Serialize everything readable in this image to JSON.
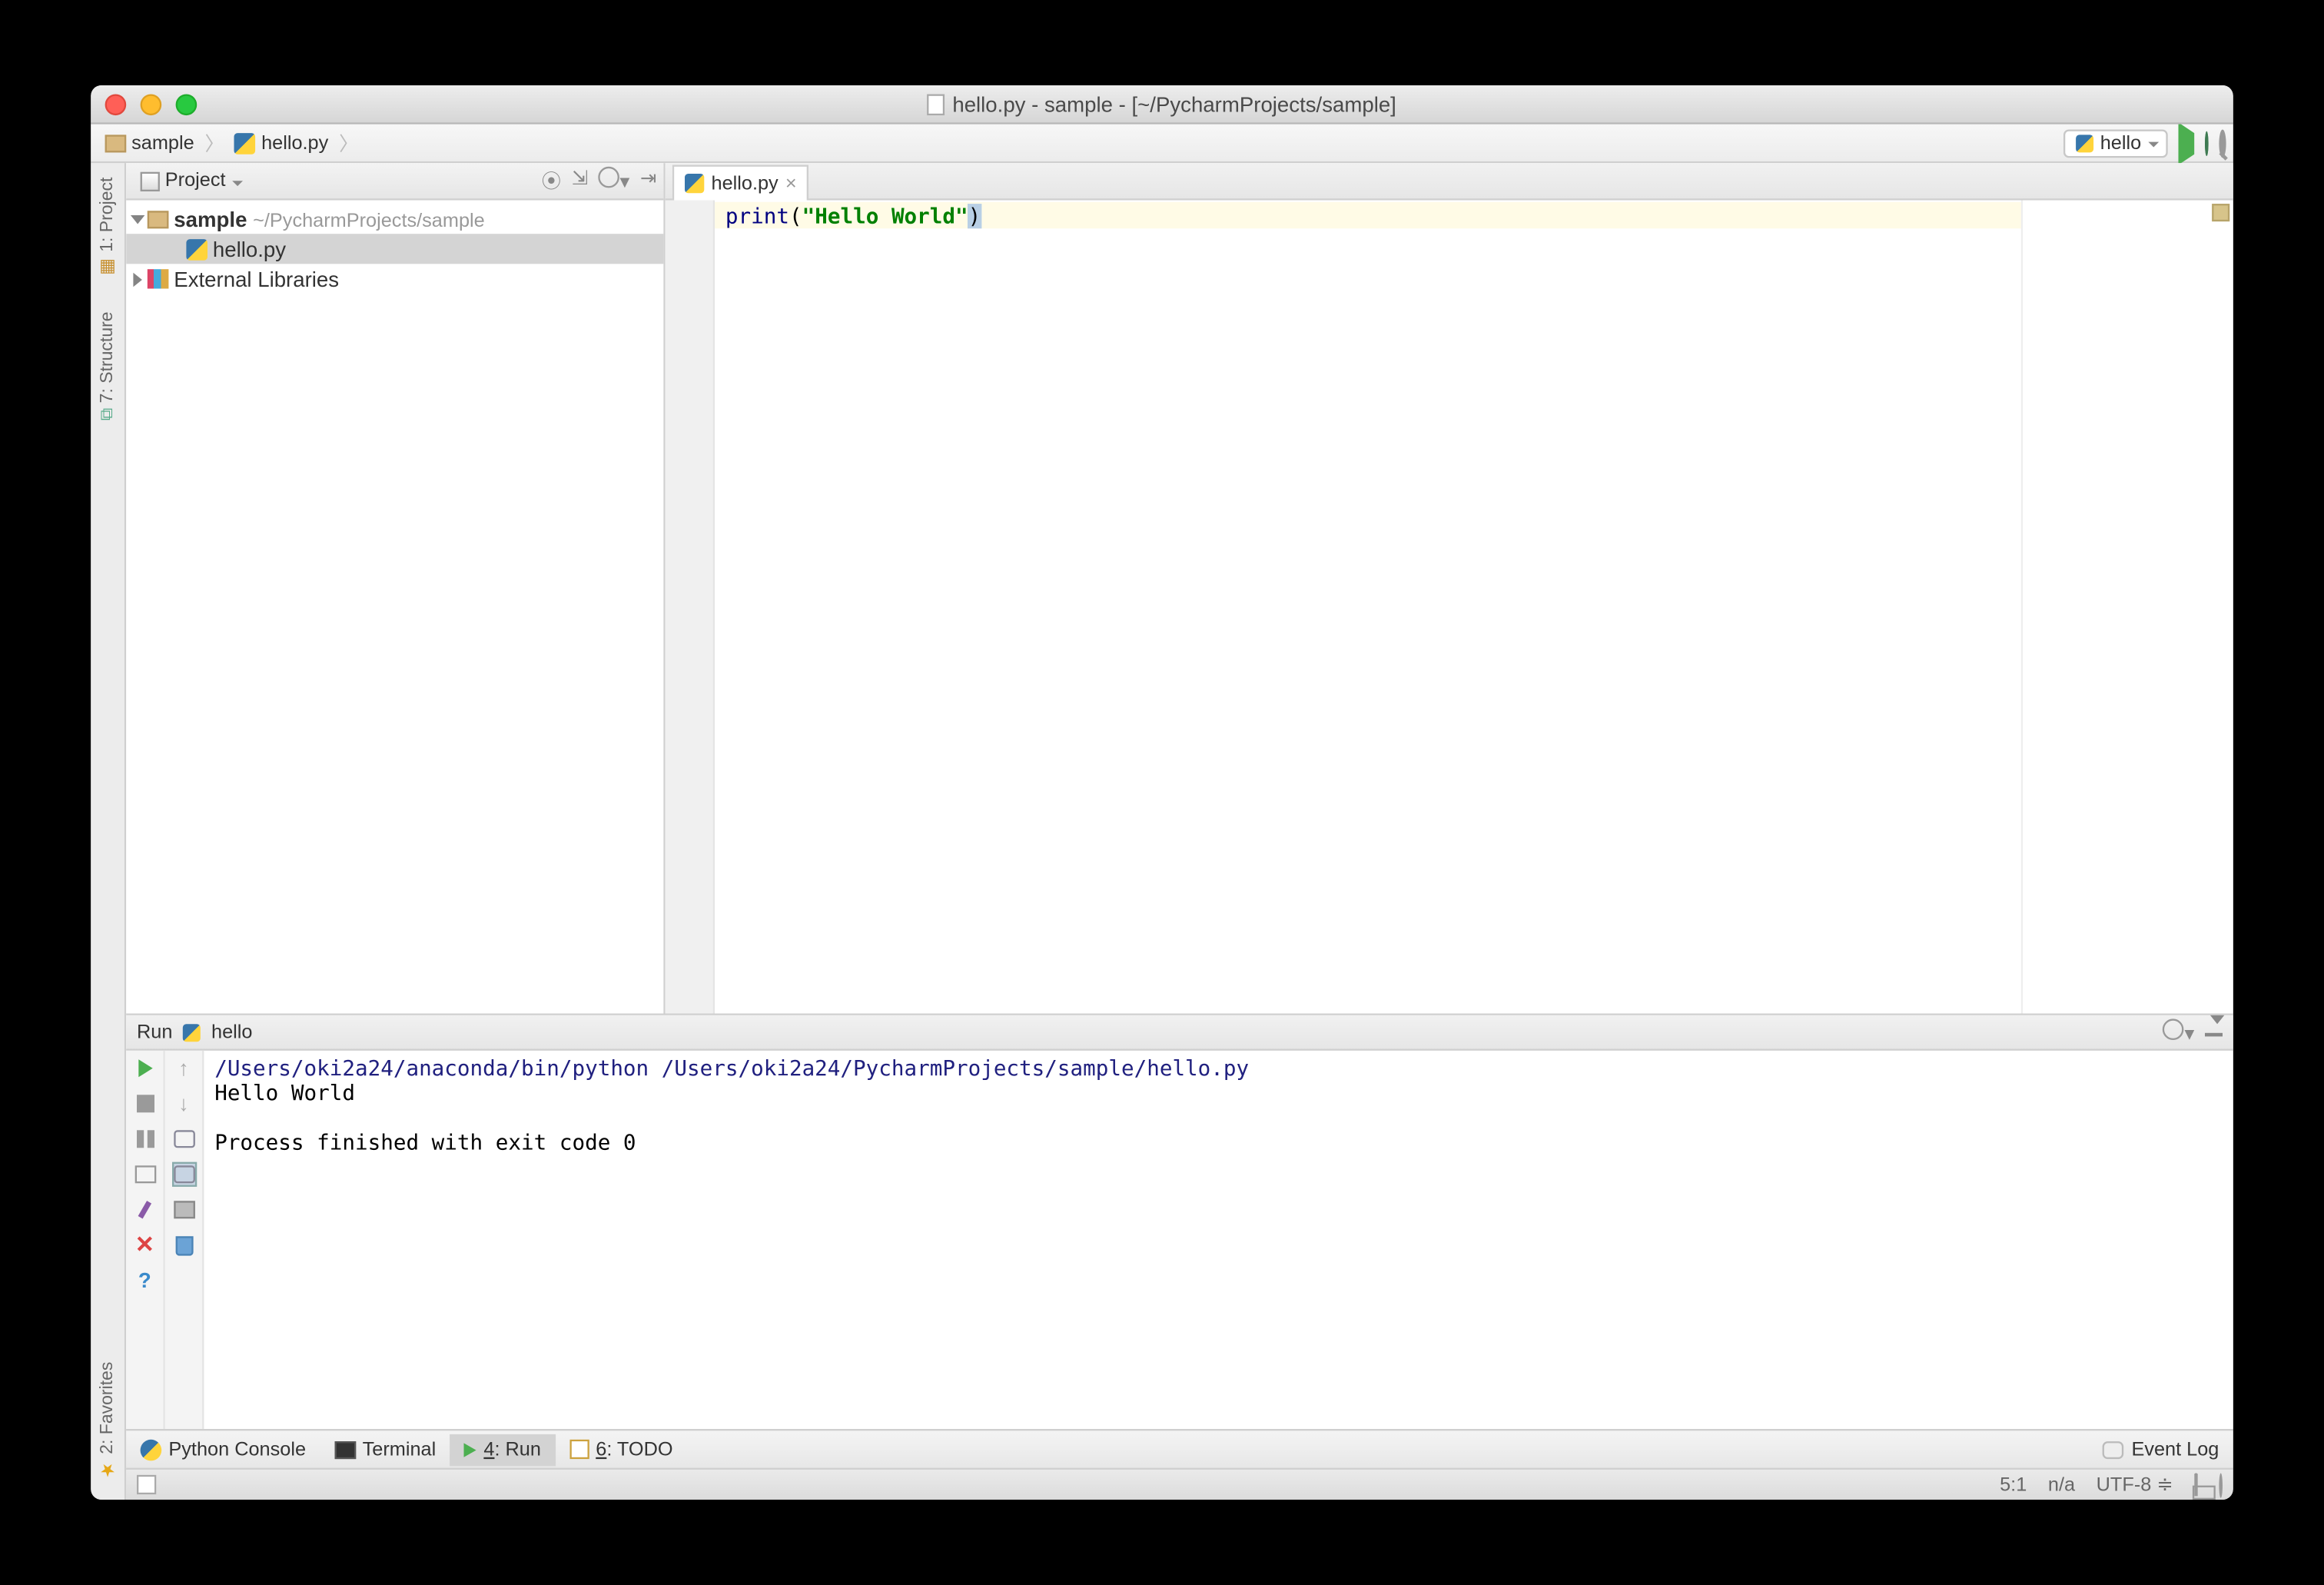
{
  "window": {
    "title": "hello.py - sample - [~/PycharmProjects/sample]"
  },
  "breadcrumb": {
    "items": [
      {
        "label": "sample",
        "kind": "folder"
      },
      {
        "label": "hello.py",
        "kind": "python"
      }
    ]
  },
  "toolbar": {
    "run_config_label": "hello"
  },
  "left_tabs": {
    "project": "1: Project",
    "structure": "7: Structure",
    "favorites": "2: Favorites"
  },
  "project_panel": {
    "title": "Project",
    "tree": {
      "root": {
        "name": "sample",
        "path": "~/PycharmProjects/sample",
        "children": [
          {
            "name": "hello.py",
            "kind": "python",
            "selected": true
          }
        ]
      },
      "external": {
        "label": "External Libraries"
      }
    }
  },
  "editor": {
    "tab_label": "hello.py",
    "code": {
      "func": "print",
      "lparen": "(",
      "string": "\"Hello World\"",
      "rparen": ")"
    }
  },
  "run_panel": {
    "header_label": "Run",
    "config_name": "hello",
    "console": {
      "command": "/Users/oki2a24/anaconda/bin/python /Users/oki2a24/PycharmProjects/sample/hello.py",
      "output": "Hello World",
      "blank": "",
      "exit": "Process finished with exit code 0"
    }
  },
  "bottom_tabs": {
    "python_console": "Python Console",
    "terminal": "Terminal",
    "run_pref": "4",
    "run_suffix": ": Run",
    "todo_pref": "6",
    "todo_suffix": ": TODO",
    "event_log": "Event Log"
  },
  "status": {
    "cursor": "5:1",
    "insert": "n/a",
    "encoding": "UTF-8"
  }
}
